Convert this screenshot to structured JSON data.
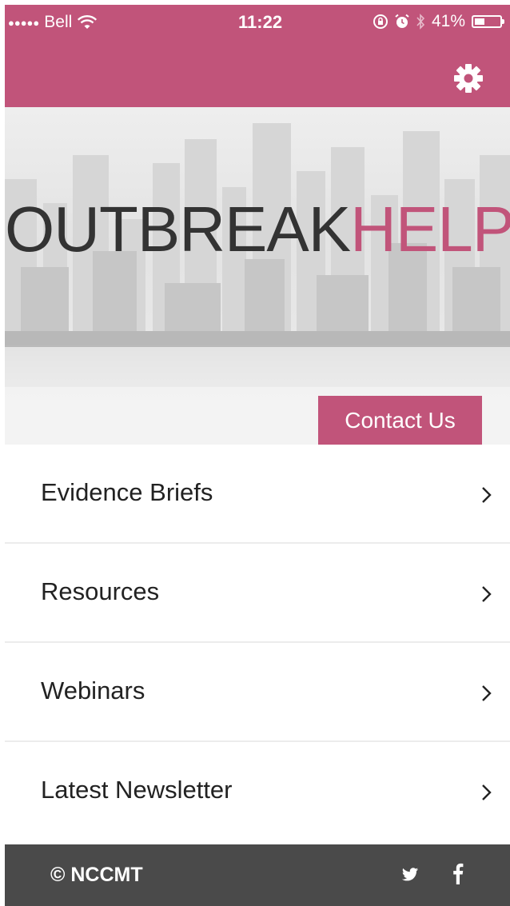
{
  "colors": {
    "accent": "#c1547a",
    "footer": "#4a4a4a",
    "text": "#222222"
  },
  "status_bar": {
    "signal_dots": "●●●●●",
    "carrier": "Bell",
    "time": "11:22",
    "battery_percent": "41%",
    "battery_level": 0.41,
    "icons": [
      "wifi-icon",
      "rotation-lock-icon",
      "alarm-icon",
      "bluetooth-icon",
      "battery-icon"
    ]
  },
  "header": {
    "settings_icon": "gear-icon"
  },
  "hero": {
    "brand_part1": "OUTBREAK",
    "brand_part2": "HELP",
    "contact_label": "Contact Us"
  },
  "menu": {
    "items": [
      {
        "label": "Evidence Briefs"
      },
      {
        "label": "Resources"
      },
      {
        "label": "Webinars"
      },
      {
        "label": "Latest Newsletter"
      }
    ],
    "chevron_icon": "chevron-right-icon"
  },
  "footer": {
    "copyright": "© NCCMT",
    "social_icons": [
      "twitter-icon",
      "facebook-icon"
    ]
  }
}
